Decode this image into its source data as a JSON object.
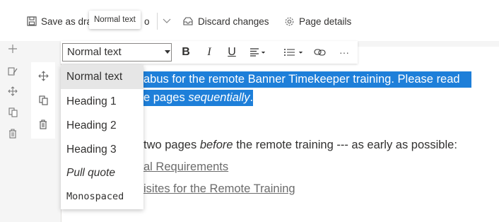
{
  "command_bar": {
    "save_label": "Save as dra",
    "save_partial": "o",
    "discard_label": "Discard changes",
    "page_details_label": "Page details",
    "tooltip": "Normal text"
  },
  "format_toolbar": {
    "style_value": "Normal text",
    "bold": "B",
    "italic": "I",
    "underline": "U",
    "more": "···"
  },
  "style_menu": {
    "items": [
      "Normal text",
      "Heading 1",
      "Heading 2",
      "Heading 3",
      "Pull quote",
      "Monospaced"
    ],
    "selected_index": 0
  },
  "content": {
    "line1": "abus for the remote Banner Timekeeper training.  Please read",
    "line2_a": "e pages ",
    "line2_b": "sequentially",
    "line2_c": ".",
    "line3_a": "two pages ",
    "line3_b": "before",
    "line3_c": " the remote training --- as early as possible:",
    "link1": "al Requirements",
    "link2": "isites for the Remote Training"
  },
  "colors": {
    "selection": "#1e7fd9",
    "accent": "#0078d4"
  }
}
